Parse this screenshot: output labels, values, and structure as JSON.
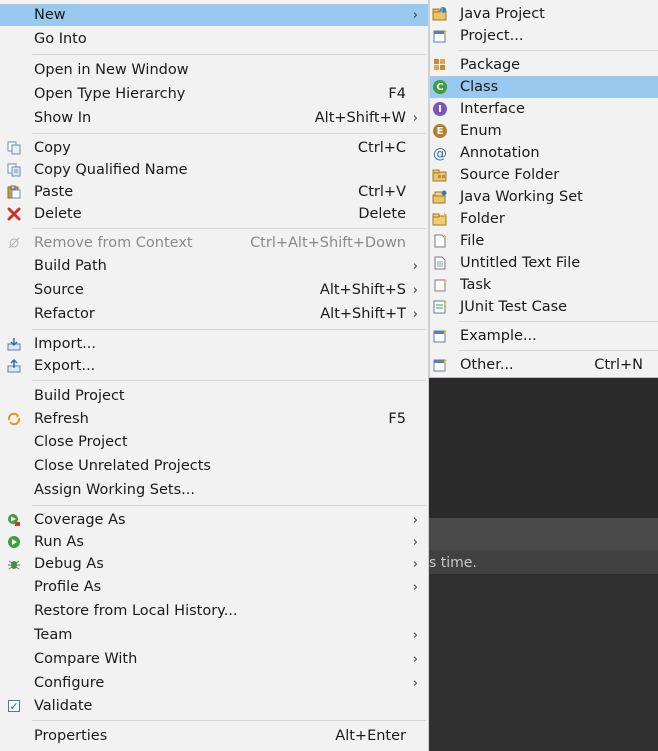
{
  "background": {
    "hint_text": "s time."
  },
  "main_menu": {
    "items": [
      {
        "label": "New",
        "accel": "",
        "submenu": true,
        "highlight": true,
        "icon": ""
      },
      {
        "label": "Go Into",
        "accel": "",
        "submenu": false,
        "icon": ""
      },
      {
        "label": "Open in New Window",
        "accel": "",
        "submenu": false,
        "icon": ""
      },
      {
        "label": "Open Type Hierarchy",
        "accel": "F4",
        "submenu": false,
        "icon": ""
      },
      {
        "label": "Show In",
        "accel": "Alt+Shift+W",
        "submenu": true,
        "icon": ""
      },
      {
        "label": "Copy",
        "accel": "Ctrl+C",
        "submenu": false,
        "icon": "copy-icon"
      },
      {
        "label": "Copy Qualified Name",
        "accel": "",
        "submenu": false,
        "icon": "copy-qualified-icon"
      },
      {
        "label": "Paste",
        "accel": "Ctrl+V",
        "submenu": false,
        "icon": "paste-icon"
      },
      {
        "label": "Delete",
        "accel": "Delete",
        "submenu": false,
        "icon": "delete-icon"
      },
      {
        "label": "Remove from Context",
        "accel": "Ctrl+Alt+Shift+Down",
        "submenu": false,
        "disabled": true,
        "icon": "remove-context-icon"
      },
      {
        "label": "Build Path",
        "accel": "",
        "submenu": true,
        "icon": ""
      },
      {
        "label": "Source",
        "accel": "Alt+Shift+S",
        "submenu": true,
        "icon": ""
      },
      {
        "label": "Refactor",
        "accel": "Alt+Shift+T",
        "submenu": true,
        "icon": ""
      },
      {
        "label": "Import...",
        "accel": "",
        "submenu": false,
        "icon": "import-icon"
      },
      {
        "label": "Export...",
        "accel": "",
        "submenu": false,
        "icon": "export-icon"
      },
      {
        "label": "Build Project",
        "accel": "",
        "submenu": false,
        "icon": ""
      },
      {
        "label": "Refresh",
        "accel": "F5",
        "submenu": false,
        "icon": "refresh-icon"
      },
      {
        "label": "Close Project",
        "accel": "",
        "submenu": false,
        "icon": ""
      },
      {
        "label": "Close Unrelated Projects",
        "accel": "",
        "submenu": false,
        "icon": ""
      },
      {
        "label": "Assign Working Sets...",
        "accel": "",
        "submenu": false,
        "icon": ""
      },
      {
        "label": "Coverage As",
        "accel": "",
        "submenu": true,
        "icon": "coverage-icon"
      },
      {
        "label": "Run As",
        "accel": "",
        "submenu": true,
        "icon": "run-icon"
      },
      {
        "label": "Debug As",
        "accel": "",
        "submenu": true,
        "icon": "debug-icon"
      },
      {
        "label": "Profile As",
        "accel": "",
        "submenu": true,
        "icon": ""
      },
      {
        "label": "Restore from Local History...",
        "accel": "",
        "submenu": false,
        "icon": ""
      },
      {
        "label": "Team",
        "accel": "",
        "submenu": true,
        "icon": ""
      },
      {
        "label": "Compare With",
        "accel": "",
        "submenu": true,
        "icon": ""
      },
      {
        "label": "Configure",
        "accel": "",
        "submenu": true,
        "icon": ""
      },
      {
        "label": "Validate",
        "accel": "",
        "submenu": false,
        "icon": "validate-checkbox-icon"
      },
      {
        "label": "Properties",
        "accel": "Alt+Enter",
        "submenu": false,
        "icon": ""
      }
    ]
  },
  "sub_menu": {
    "items": [
      {
        "label": "Java Project",
        "accel": "",
        "icon": "java-project-icon"
      },
      {
        "label": "Project...",
        "accel": "",
        "icon": "project-icon"
      },
      {
        "label": "Package",
        "accel": "",
        "icon": "package-icon"
      },
      {
        "label": "Class",
        "accel": "",
        "highlight": true,
        "icon": "class-icon"
      },
      {
        "label": "Interface",
        "accel": "",
        "icon": "interface-icon"
      },
      {
        "label": "Enum",
        "accel": "",
        "icon": "enum-icon"
      },
      {
        "label": "Annotation",
        "accel": "",
        "icon": "annotation-icon"
      },
      {
        "label": "Source Folder",
        "accel": "",
        "icon": "source-folder-icon"
      },
      {
        "label": "Java Working Set",
        "accel": "",
        "icon": "working-set-icon"
      },
      {
        "label": "Folder",
        "accel": "",
        "icon": "folder-icon"
      },
      {
        "label": "File",
        "accel": "",
        "icon": "file-icon"
      },
      {
        "label": "Untitled Text File",
        "accel": "",
        "icon": "text-file-icon"
      },
      {
        "label": "Task",
        "accel": "",
        "icon": "task-icon"
      },
      {
        "label": "JUnit Test Case",
        "accel": "",
        "icon": "junit-icon"
      },
      {
        "label": "Example...",
        "accel": "",
        "icon": "example-icon"
      },
      {
        "label": "Other...",
        "accel": "Ctrl+N",
        "icon": "other-icon"
      }
    ]
  },
  "colors": {
    "menu_bg": "#f2f2f2",
    "highlight": "#99c9ef",
    "separator": "#d5d5d5",
    "editor_bg": "#2f2f2f"
  }
}
